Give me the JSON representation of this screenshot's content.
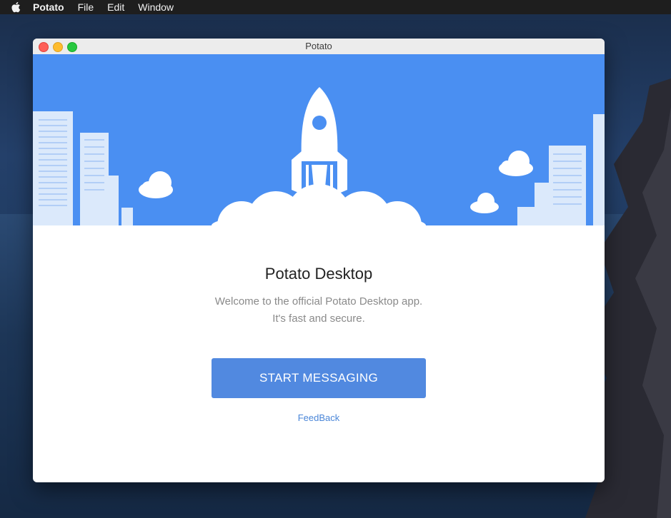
{
  "menubar": {
    "icon": "apple-logo-icon",
    "items": [
      "Potato",
      "File",
      "Edit",
      "Window"
    ]
  },
  "window": {
    "title": "Potato",
    "controls": [
      "close",
      "minimize",
      "zoom"
    ]
  },
  "hero": {
    "icons": [
      "rocket-icon",
      "cloud-icon",
      "building-icon"
    ],
    "background": "#4a8ff2"
  },
  "main": {
    "title": "Potato Desktop",
    "description_line1": "Welcome to the official Potato Desktop app.",
    "description_line2": "It's fast and secure.",
    "start_button": "START MESSAGING",
    "feedback_link": "FeedBack"
  },
  "colors": {
    "accent": "#5189e0",
    "link": "#4a86d8"
  }
}
